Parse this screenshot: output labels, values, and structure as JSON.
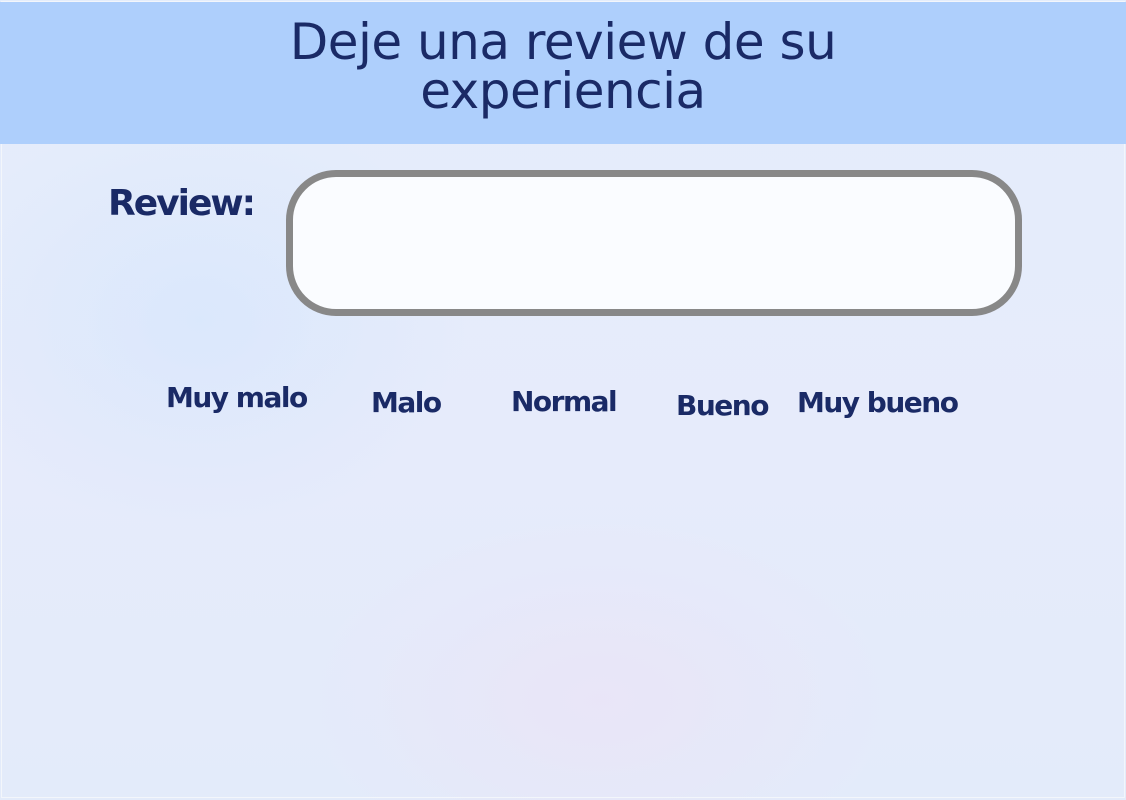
{
  "header": {
    "title_line1": "Deje una review de su",
    "title_line2": "experiencia",
    "background": "#aecffc",
    "text_color": "#1a2a66"
  },
  "form": {
    "review_label": "Review:",
    "review_value": "",
    "review_placeholder": ""
  },
  "ratings": {
    "options": [
      {
        "label": "Muy malo"
      },
      {
        "label": "Malo"
      },
      {
        "label": "Normal"
      },
      {
        "label": "Bueno"
      },
      {
        "label": "Muy bueno"
      }
    ]
  }
}
